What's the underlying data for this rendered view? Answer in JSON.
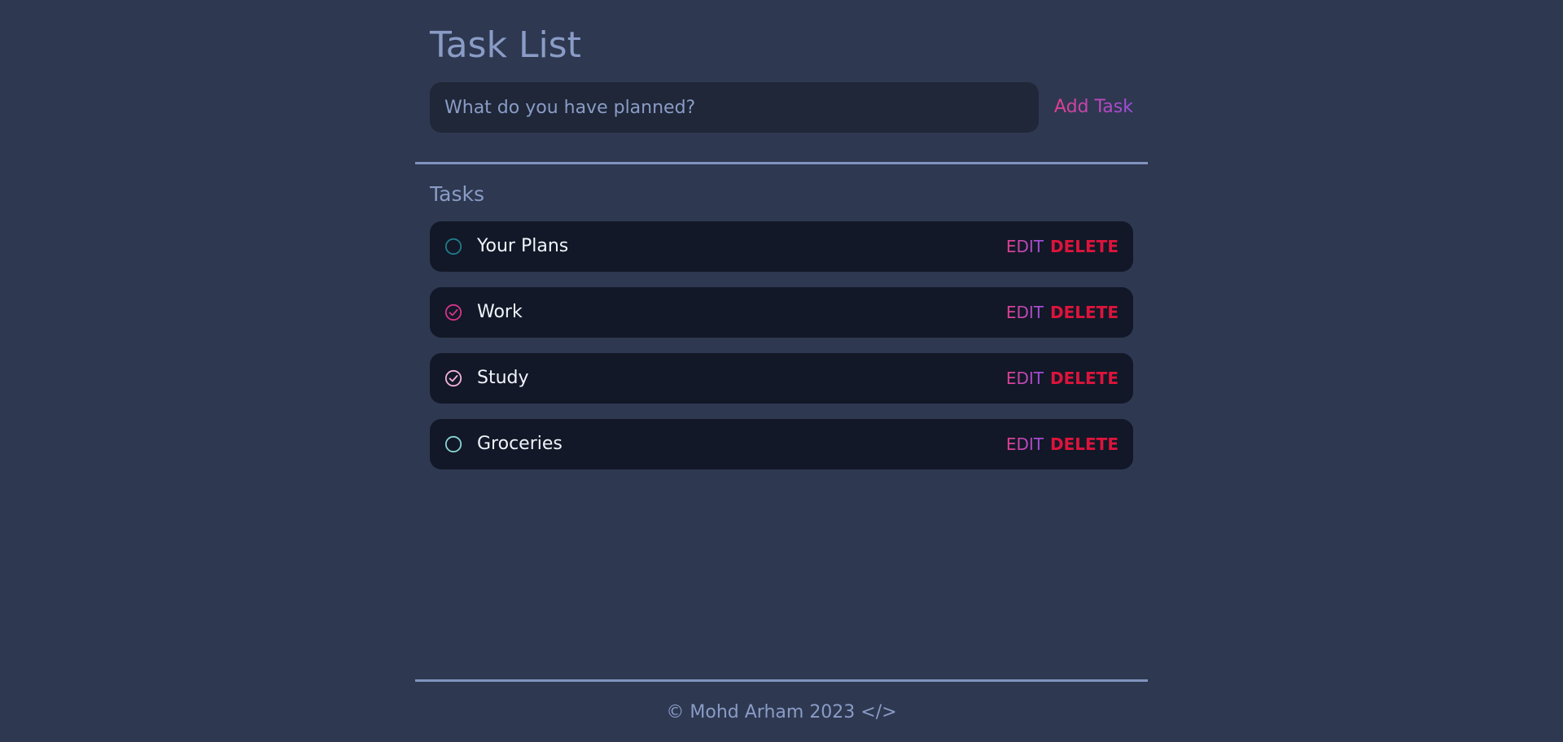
{
  "app": {
    "title": "Task List"
  },
  "new_task": {
    "placeholder": "What do you have planned?",
    "value": "",
    "add_label": "Add Task"
  },
  "tasks_section": {
    "heading": "Tasks"
  },
  "tasks": [
    {
      "name": "Your Plans",
      "status": "unchecked",
      "check_color": "#1f7c8c",
      "edit_label": "EDIT",
      "delete_label": "DELETE"
    },
    {
      "name": "Work",
      "status": "checked",
      "check_color": "#d6338a",
      "edit_label": "EDIT",
      "delete_label": "DELETE"
    },
    {
      "name": "Study",
      "status": "checked",
      "check_color": "#f5b3e0",
      "edit_label": "EDIT",
      "delete_label": "DELETE"
    },
    {
      "name": "Groceries",
      "status": "unchecked",
      "check_color": "#8ad4d4",
      "edit_label": "EDIT",
      "delete_label": "DELETE"
    }
  ],
  "footer": {
    "text": "© Mohd Arham 2023 </>"
  },
  "colors": {
    "background": "#2e3851",
    "input_background": "#1f2738",
    "task_background": "#121827",
    "muted_text": "#8a9cc6",
    "accent_gradient_start": "#e0408e",
    "accent_gradient_end": "#9d4edd",
    "delete": "#dc143c",
    "divider": "#8194bf"
  }
}
